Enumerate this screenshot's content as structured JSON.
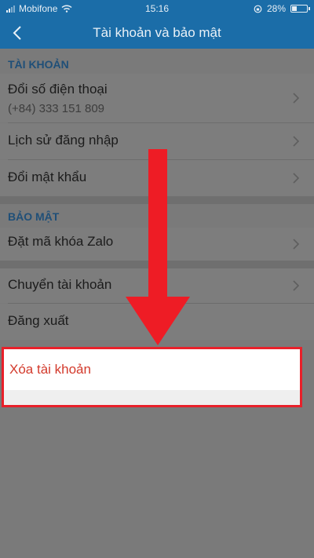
{
  "status_bar": {
    "carrier": "Mobifone",
    "time": "15:16",
    "battery": "28%"
  },
  "nav": {
    "title": "Tài khoản và bảo mật"
  },
  "sections": {
    "account": {
      "header": "TÀI KHOẢN",
      "change_phone": {
        "label": "Đổi số điện thoại",
        "value": "(+84) 333 151 809"
      },
      "login_history": "Lịch sử đăng nhập",
      "change_password": "Đổi mật khẩu"
    },
    "security": {
      "header": "BẢO MẬT",
      "zalo_lock": "Đặt mã khóa Zalo"
    },
    "actions": {
      "switch_account": "Chuyển tài khoản",
      "logout": "Đăng xuất",
      "delete_account": "Xóa tài khoản"
    }
  },
  "colors": {
    "header_blue": "#1b6da8",
    "delete_red": "#d33a2c",
    "highlight_border": "#e8202a",
    "arrow_red": "#ee1c25"
  },
  "icons": {
    "back": "chevron-left-icon",
    "row_chevron": "chevron-right-icon",
    "annotation": "arrow-down-icon"
  }
}
